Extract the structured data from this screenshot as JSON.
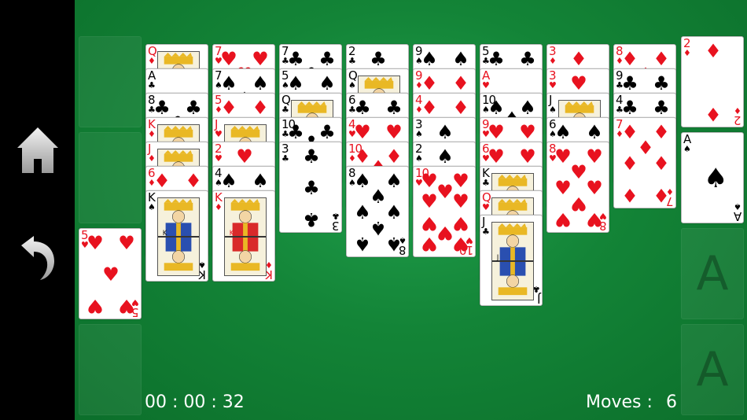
{
  "sidebar": {
    "home_icon": "home-icon",
    "undo_icon": "undo-icon"
  },
  "hud": {
    "timer": "00 : 00 : 32",
    "moves_label": "Moves :",
    "moves_value": "6"
  },
  "colors": {
    "table": "#138437",
    "red_suit": "#e8121f",
    "black_suit": "#000000"
  },
  "freecells": [
    null,
    null,
    {
      "rank": "5",
      "suit": "hearts"
    },
    null
  ],
  "foundations": [
    {
      "rank": "2",
      "suit": "diamonds"
    },
    {
      "rank": "A",
      "suit": "spades"
    },
    {
      "placeholder": "A"
    },
    {
      "placeholder": "A"
    }
  ],
  "tableau": [
    [
      {
        "rank": "Q",
        "suit": "diamonds"
      },
      {
        "rank": "A",
        "suit": "clubs"
      },
      {
        "rank": "8",
        "suit": "clubs"
      },
      {
        "rank": "K",
        "suit": "diamonds"
      },
      {
        "rank": "J",
        "suit": "diamonds"
      },
      {
        "rank": "6",
        "suit": "diamonds"
      },
      {
        "rank": "K",
        "suit": "spades"
      }
    ],
    [
      {
        "rank": "7",
        "suit": "hearts"
      },
      {
        "rank": "7",
        "suit": "spades"
      },
      {
        "rank": "5",
        "suit": "diamonds"
      },
      {
        "rank": "J",
        "suit": "hearts"
      },
      {
        "rank": "2",
        "suit": "hearts"
      },
      {
        "rank": "4",
        "suit": "spades"
      },
      {
        "rank": "K",
        "suit": "diamonds"
      }
    ],
    [
      {
        "rank": "7",
        "suit": "clubs"
      },
      {
        "rank": "5",
        "suit": "spades"
      },
      {
        "rank": "Q",
        "suit": "clubs"
      },
      {
        "rank": "10",
        "suit": "clubs"
      },
      {
        "rank": "3",
        "suit": "clubs"
      }
    ],
    [
      {
        "rank": "2",
        "suit": "clubs"
      },
      {
        "rank": "Q",
        "suit": "spades"
      },
      {
        "rank": "6",
        "suit": "clubs"
      },
      {
        "rank": "4",
        "suit": "hearts"
      },
      {
        "rank": "10",
        "suit": "diamonds"
      },
      {
        "rank": "8",
        "suit": "spades"
      }
    ],
    [
      {
        "rank": "9",
        "suit": "spades"
      },
      {
        "rank": "9",
        "suit": "diamonds"
      },
      {
        "rank": "4",
        "suit": "diamonds"
      },
      {
        "rank": "3",
        "suit": "spades"
      },
      {
        "rank": "2",
        "suit": "spades"
      },
      {
        "rank": "10",
        "suit": "hearts"
      }
    ],
    [
      {
        "rank": "5",
        "suit": "clubs"
      },
      {
        "rank": "A",
        "suit": "hearts"
      },
      {
        "rank": "10",
        "suit": "spades"
      },
      {
        "rank": "9",
        "suit": "hearts"
      },
      {
        "rank": "6",
        "suit": "hearts"
      },
      {
        "rank": "K",
        "suit": "clubs"
      },
      {
        "rank": "Q",
        "suit": "hearts"
      },
      {
        "rank": "J",
        "suit": "clubs"
      }
    ],
    [
      {
        "rank": "3",
        "suit": "diamonds"
      },
      {
        "rank": "3",
        "suit": "hearts"
      },
      {
        "rank": "J",
        "suit": "spades"
      },
      {
        "rank": "6",
        "suit": "spades"
      },
      {
        "rank": "8",
        "suit": "hearts"
      }
    ],
    [
      {
        "rank": "8",
        "suit": "diamonds"
      },
      {
        "rank": "9",
        "suit": "clubs"
      },
      {
        "rank": "4",
        "suit": "clubs"
      },
      {
        "rank": "7",
        "suit": "diamonds"
      }
    ]
  ]
}
